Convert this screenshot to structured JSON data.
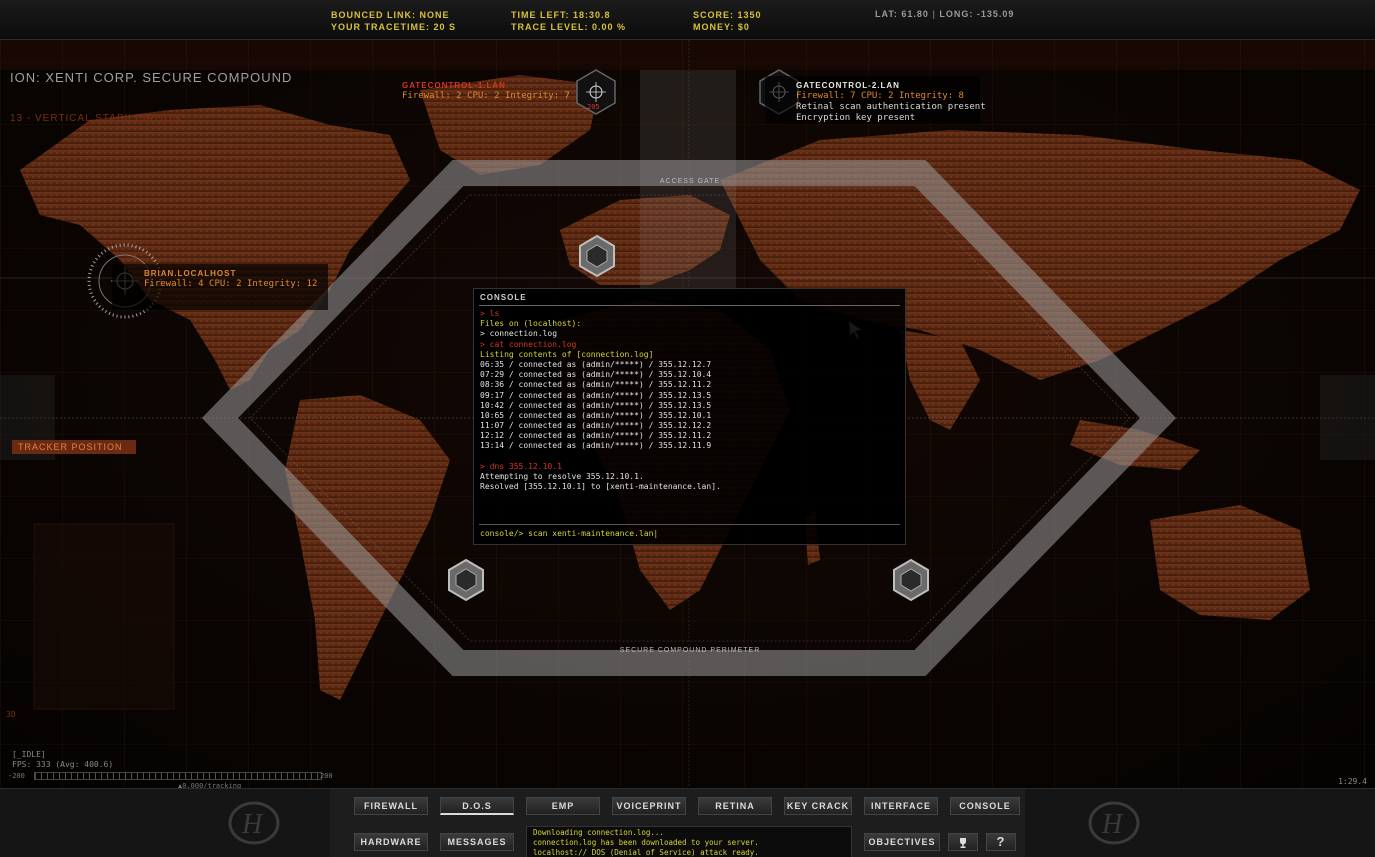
{
  "hud": {
    "bounced_link": "Bounced link: NONE",
    "trace_time": "Your tracetime: 20 s",
    "time_left": "Time left: 18:30.8",
    "trace_level": "Trace level: 0.00 %",
    "score": "Score: 1350",
    "money": "Money: $0",
    "lat": "Lat: 61.80",
    "long": "Long: -135.09"
  },
  "location": {
    "title": "ion: Xenti Corp. Secure compound",
    "subtitle": "13 - vertical stabilisation",
    "tracker": "Tracker position"
  },
  "nodes": {
    "gate1": {
      "name": "Gatecontrol-1.lan",
      "stats": "Firewall: 2 CPU: 2 Integrity: 7",
      "counter": "205"
    },
    "gate2": {
      "name": "Gatecontrol-2.lan",
      "stats": "Firewall: 7 CPU: 2 Integrity: 8",
      "extra1": "Retinal scan authentication present",
      "extra2": "Encryption key present"
    },
    "local": {
      "name": "Brian.localhost",
      "stats": "Firewall: 4 CPU: 2 Integrity: 12"
    }
  },
  "zones": {
    "access_gate": "Access Gate",
    "perimeter": "Secure compound perimeter"
  },
  "console": {
    "title": "Console",
    "lines": [
      {
        "t": "> ls",
        "c": "cmd"
      },
      {
        "t": "Files on (localhost):",
        "c": "hdr"
      },
      {
        "t": "> connection.log",
        "c": "out"
      },
      {
        "t": "> cat connection.log",
        "c": "cmd"
      },
      {
        "t": "Listing contents of [connection.log]",
        "c": "hdr"
      },
      {
        "t": "06:35 / connected as (admin/*****) / 355.12.12.7",
        "c": "out"
      },
      {
        "t": "07:29 / connected as (admin/*****) / 355.12.10.4",
        "c": "out"
      },
      {
        "t": "08:36 / connected as (admin/*****) / 355.12.11.2",
        "c": "out"
      },
      {
        "t": "09:17 / connected as (admin/*****) / 355.12.13.5",
        "c": "out"
      },
      {
        "t": "10:42 / connected as (admin/*****) / 355.12.13.5",
        "c": "out"
      },
      {
        "t": "10:65 / connected as (admin/*****) / 355.12.10.1",
        "c": "out"
      },
      {
        "t": "11:07 / connected as (admin/*****) / 355.12.12.2",
        "c": "out"
      },
      {
        "t": "12:12 / connected as (admin/*****) / 355.12.11.2",
        "c": "out"
      },
      {
        "t": "13:14 / connected as (admin/*****) / 355.12.11.9",
        "c": "out"
      },
      {
        "t": "",
        "c": "out"
      },
      {
        "t": "> dns 355.12.10.1",
        "c": "cmd"
      },
      {
        "t": "Attempting to resolve 355.12.10.1.",
        "c": "out"
      },
      {
        "t": "Resolved [355.12.10.1] to [xenti-maintenance.lan].",
        "c": "out"
      }
    ],
    "prompt": "console/> scan xenti-maintenance.lan|"
  },
  "debug": {
    "idle": "[_IDLE]",
    "fps": "FPS: 333 (Avg: 400.6)",
    "tl_min": "-200",
    "tl_max": "200",
    "tl_tracking": "▲0.000/tracking",
    "clock": "1:29.4",
    "left_letters": "3D"
  },
  "toolbar": {
    "row1": [
      "Firewall",
      "D.O.S",
      "EMP",
      "Voiceprint",
      "Retina",
      "Key crack",
      "Interface",
      "Console"
    ],
    "row2": [
      "Hardware",
      "Messages"
    ],
    "objectives": "Objectives",
    "trophy_icon": "trophy-icon",
    "help": "?"
  },
  "messages": [
    "Downloading connection.log...",
    "connection.log has been downloaded to your server.",
    "localhost:// DOS (Denial of Service) attack ready."
  ],
  "colors": {
    "accent_orange": "#e0892e",
    "accent_red": "#d8351f",
    "accent_yellow": "#d8d432"
  }
}
